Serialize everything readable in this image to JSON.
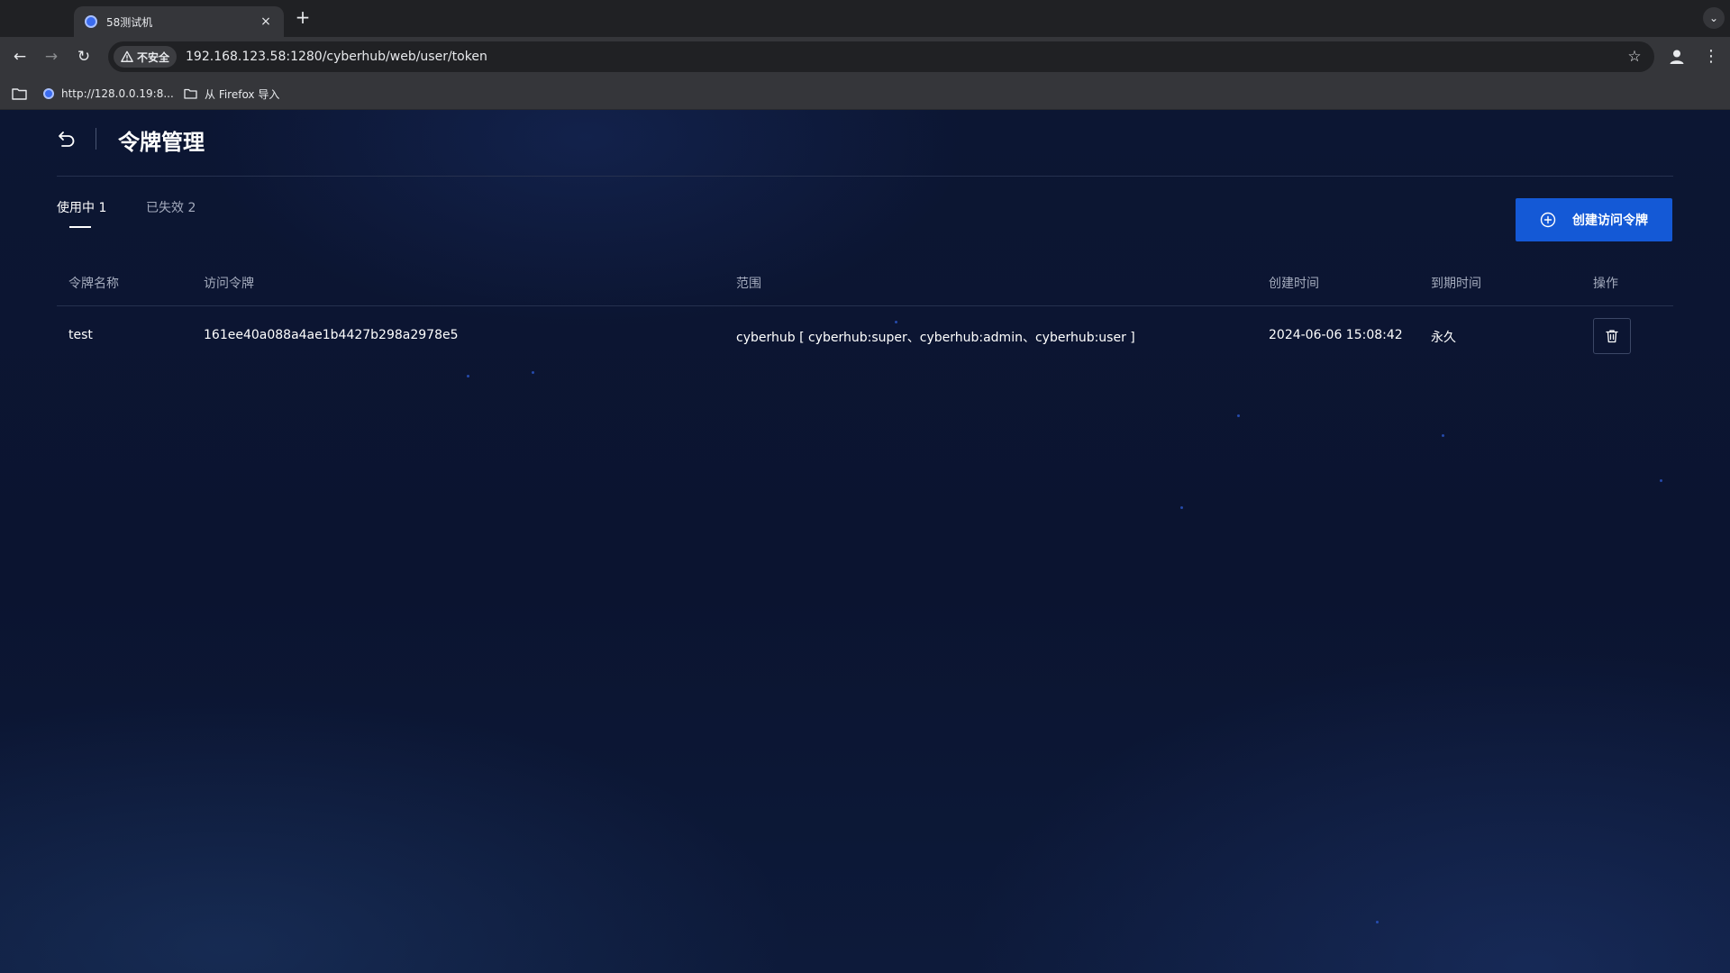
{
  "browser": {
    "tab": {
      "title": "58测试机",
      "close_label": "×"
    },
    "new_tab_label": "+",
    "tab_menu_label": "⌄",
    "nav": {
      "back": "←",
      "forward": "→",
      "reload": "↻"
    },
    "security_label": "不安全",
    "url": "192.168.123.58:1280/cyberhub/web/user/token",
    "star": "☆",
    "menu": "⋮",
    "bookmarks": [
      {
        "label": "http://128.0.0.19:8..."
      },
      {
        "label": "从 Firefox 导入"
      }
    ]
  },
  "page": {
    "title": "令牌管理",
    "tabs": [
      {
        "label": "使用中 1",
        "active": true
      },
      {
        "label": "已失效 2",
        "active": false
      }
    ],
    "create_button": "创建访问令牌",
    "table": {
      "columns": [
        "令牌名称",
        "访问令牌",
        "范围",
        "创建时间",
        "到期时间",
        "操作"
      ],
      "rows": [
        {
          "name": "test",
          "token": "161ee40a088a4ae1b4427b298a2978e5",
          "scope": "cyberhub [ cyberhub:super、cyberhub:admin、cyberhub:user ]",
          "created": "2024-06-06 15:08:42",
          "expires": "永久"
        }
      ]
    }
  },
  "colors": {
    "accent": "#1459d6",
    "background": "#0b1430",
    "muted_text": "#a4abbd"
  }
}
